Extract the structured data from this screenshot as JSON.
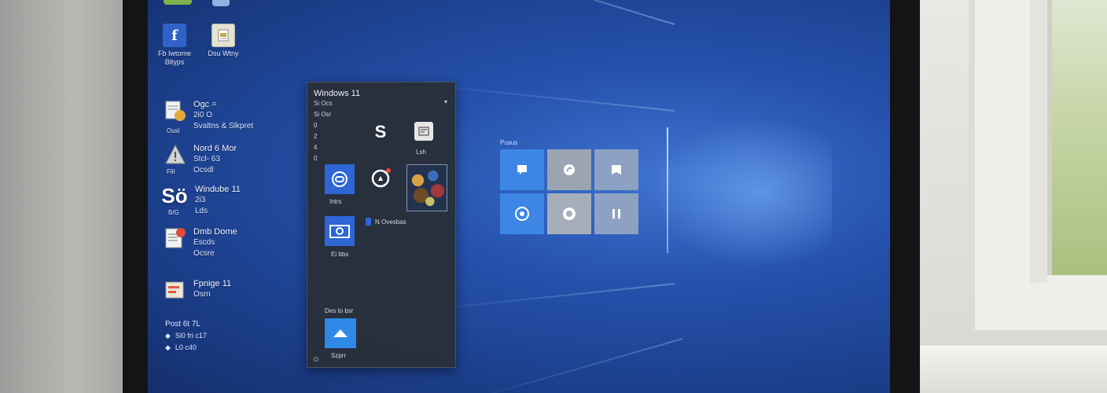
{
  "desktop": {
    "top_icons": [
      {
        "id": "app1",
        "icon": "facebook-icon",
        "label_line1": "Fb Iwtome",
        "label_line2": "Bityps",
        "color": "#2f63c8"
      },
      {
        "id": "app2",
        "icon": "document-icon",
        "label_line1": "Dsu Wtny",
        "label_line2": "",
        "color": "#d9d9c8"
      }
    ],
    "list_items": [
      {
        "icon": "files-icon",
        "line1": "Ogc =",
        "line2": "2i0 O",
        "line3": "Svaltns & Slkpret",
        "caption": "Ousl",
        "color": "#e0a93a"
      },
      {
        "icon": "warning-icon",
        "line1": "Nord 6 Mor",
        "line2": "Stcl- 63",
        "line3": "Ocsdl",
        "caption": "Flil",
        "color": "#c9c9c9"
      },
      {
        "icon": "so-icon",
        "line1": "Windube 11",
        "line2": "2i3",
        "line3": "Lds",
        "caption": "B/G",
        "color": "#ffffff"
      },
      {
        "icon": "notes-icon",
        "line1": "Dmb Dome",
        "line2": "Escds",
        "line3": "Ocsre",
        "caption": "",
        "color": "#e04b3a"
      },
      {
        "icon": "folder-red-icon",
        "line1": "Fpnige 11",
        "line2": "Osrn",
        "line3": "",
        "caption": "",
        "color": "#e05a4a"
      }
    ],
    "bottom_block": {
      "title": "Post 6t 7L",
      "items": [
        "Sl0 fri c17",
        "L0 c40"
      ]
    }
  },
  "start_menu": {
    "title": "Windows 11",
    "subtitle": "Si Ocs",
    "dropdown": "▾",
    "list_header": "Si Osr",
    "numbers": [
      "0",
      "2",
      "4",
      "0"
    ],
    "top_tiles": [
      {
        "icon": "s-logo-icon",
        "label": ""
      },
      {
        "icon": "news-icon",
        "label": "Lsh"
      }
    ],
    "tiles": [
      {
        "icon": "link-icon",
        "label": "Intrs",
        "color": "#2e66d6"
      },
      {
        "icon": "alarm-icon",
        "label": "",
        "color": "transparent"
      },
      {
        "icon": "photo-icon",
        "label": "",
        "color": "#1b2a44"
      },
      {
        "icon": "camera-icon",
        "label": "Ei bbs",
        "color": "#2e66d6"
      }
    ],
    "inline_item": "N Ovesbas",
    "pinned_header": "Des to bsr",
    "pinned_label": "Szprr",
    "pinned_color": "#2e88e6",
    "power": "⏻"
  },
  "tile_group": {
    "label": "Pusus",
    "tiles": [
      {
        "icon": "chat-icon",
        "color": "#3d86e6"
      },
      {
        "icon": "edge-icon",
        "color": "#9aa4b3"
      },
      {
        "icon": "flag-icon",
        "color": "#8da2c2"
      },
      {
        "icon": "disc-icon",
        "color": "#3d86e6"
      },
      {
        "icon": "search-ring-icon",
        "color": "#a7aebb"
      },
      {
        "icon": "pause-icon",
        "color": "#8da2c2"
      }
    ]
  }
}
